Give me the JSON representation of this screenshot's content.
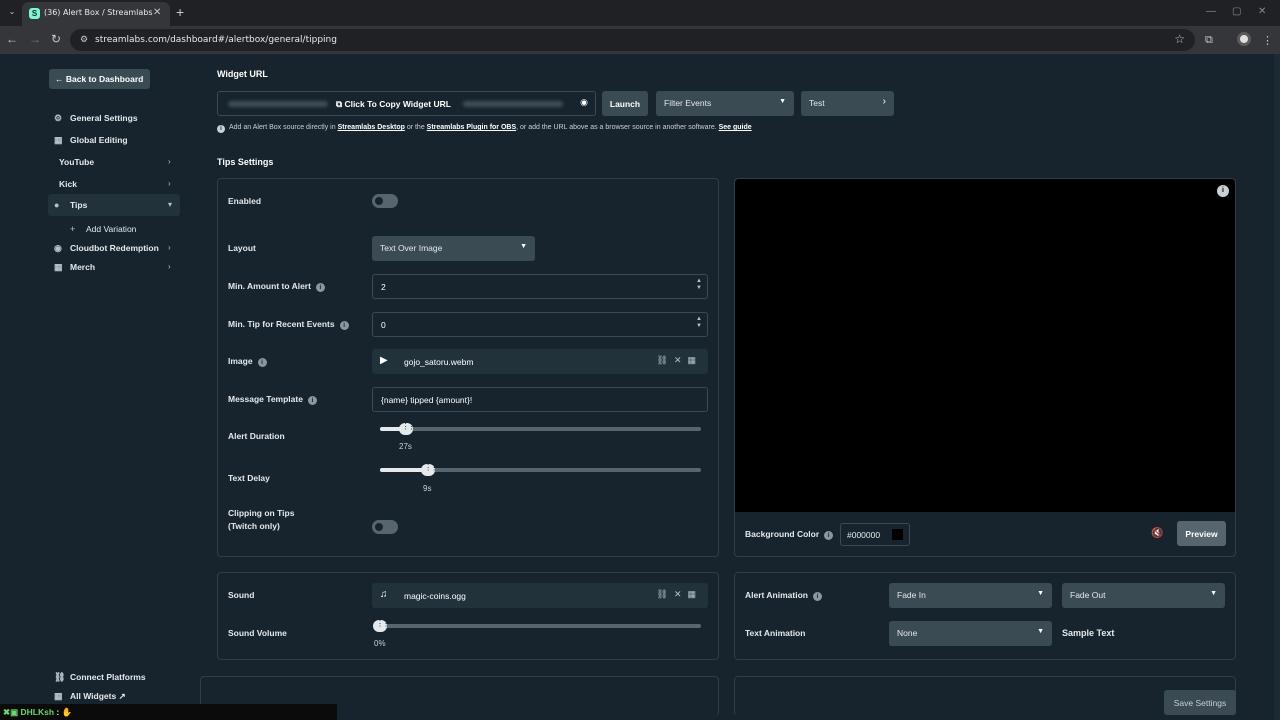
{
  "browser": {
    "tab_title": "(36) Alert Box / Streamlabs",
    "tab_favicon": "S",
    "url": "streamlabs.com/dashboard#/alertbox/general/tipping"
  },
  "sidebar": {
    "back_label": "Back to Dashboard",
    "items": [
      {
        "label": "General Settings",
        "icon": "gear-icon"
      },
      {
        "label": "Global Editing",
        "icon": "grid-icon"
      },
      {
        "label": "YouTube"
      },
      {
        "label": "Kick"
      },
      {
        "label": "Tips",
        "icon": "coins-icon"
      },
      {
        "label": "Add Variation",
        "icon": "plus-icon"
      },
      {
        "label": "Cloudbot Redemption",
        "icon": "bot-icon"
      },
      {
        "label": "Merch",
        "icon": "grid-icon"
      }
    ],
    "bottom": [
      {
        "label": "Connect Platforms",
        "icon": "link-icon"
      },
      {
        "label": "All Widgets",
        "icon": "widgets-icon"
      }
    ]
  },
  "widget": {
    "heading": "Widget URL",
    "copy_label": "Click To Copy Widget URL",
    "launch_label": "Launch",
    "filter_label": "Filter Events",
    "test_label": "Test",
    "info_text_1": "Add an Alert Box source directly in ",
    "info_link_1": "Streamlabs Desktop",
    "info_text_2": " or the ",
    "info_link_2": "Streamlabs Plugin for OBS",
    "info_text_3": ", or add the URL above as a browser source in another software. ",
    "info_link_3": "See guide"
  },
  "tips": {
    "heading": "Tips Settings",
    "enabled_label": "Enabled",
    "enabled": false,
    "layout_label": "Layout",
    "layout_value": "Text Over Image",
    "min_amount_label": "Min. Amount to Alert",
    "min_amount_value": "2",
    "min_tip_label": "Min. Tip for Recent Events",
    "min_tip_value": "0",
    "image_label": "Image",
    "image_file": "gojo_satoru.webm",
    "message_label": "Message Template",
    "message_value": "{name} tipped {amount}!",
    "duration_label": "Alert Duration",
    "duration_value": "27s",
    "duration_fraction": 0.08,
    "delay_label": "Text Delay",
    "delay_value": "9s",
    "delay_fraction": 0.15,
    "clipping_label_1": "Clipping on Tips",
    "clipping_label_2": "(Twitch only)",
    "clipping_enabled": false
  },
  "preview": {
    "bg_color_label": "Background Color",
    "bg_color_value": "#000000",
    "preview_label": "Preview"
  },
  "sound": {
    "sound_label": "Sound",
    "sound_file": "magic-coins.ogg",
    "volume_label": "Sound Volume",
    "volume_value": "0%",
    "volume_fraction": 0
  },
  "animation": {
    "alert_label": "Alert Animation",
    "in_value": "Fade In",
    "out_value": "Fade Out",
    "text_label": "Text Animation",
    "text_value": "None",
    "sample_text": "Sample Text"
  },
  "footer": {
    "save_label": "Save Settings",
    "chat_user": "DHLKsh",
    "chat_sep": " : "
  },
  "colors": {
    "background": "#17242d",
    "button": "#3a4b54",
    "accent_text": "#e6e9ec"
  }
}
